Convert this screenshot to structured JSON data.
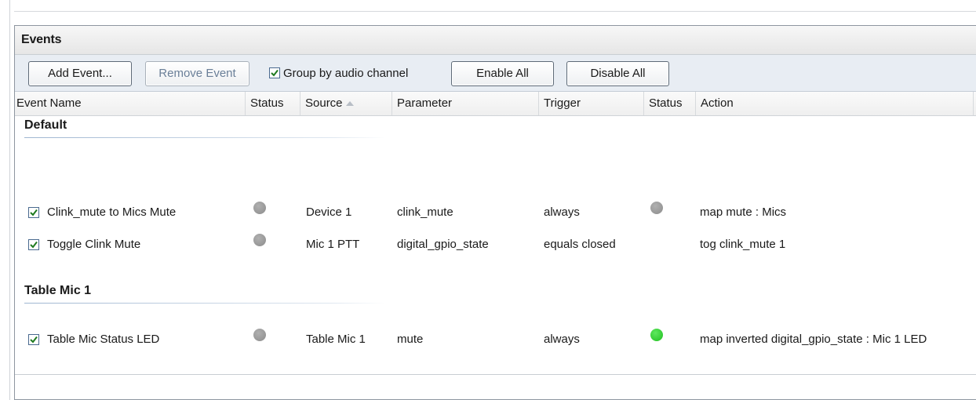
{
  "panel": {
    "title": "Events"
  },
  "toolbar": {
    "add_event": "Add Event...",
    "remove_event": "Remove Event",
    "group_by_label": "Group by audio channel",
    "group_by_checked": true,
    "enable_all": "Enable All",
    "disable_all": "Disable All"
  },
  "columns": [
    "Event Name",
    "Status",
    "Source",
    "Parameter",
    "Trigger",
    "Status",
    "Action"
  ],
  "sort": {
    "column": "Source",
    "direction": "ascending"
  },
  "groups": [
    {
      "name": "Default",
      "events": [
        {
          "enabled": true,
          "name": "Clink_mute to Mics Mute",
          "status": "gray",
          "source": "Device 1",
          "parameter": "clink_mute",
          "trigger": "always",
          "action_status": "gray",
          "action": "map mute : Mics"
        },
        {
          "enabled": true,
          "name": "Toggle Clink Mute",
          "status": "gray",
          "source": "Mic 1 PTT",
          "parameter": "digital_gpio_state",
          "trigger": "equals closed",
          "action_status": "",
          "action": "tog clink_mute 1"
        }
      ]
    },
    {
      "name": "Table Mic 1",
      "events": [
        {
          "enabled": true,
          "name": "Table Mic Status LED",
          "status": "gray",
          "source": "Table Mic 1",
          "parameter": "mute",
          "trigger": "always",
          "action_status": "green",
          "action": "map inverted digital_gpio_state : Mic 1 LED"
        }
      ]
    }
  ],
  "colors": {
    "status_gray": "#9a9a9a",
    "status_green": "#22c322",
    "toolbar_bg": "#e8edf3"
  }
}
